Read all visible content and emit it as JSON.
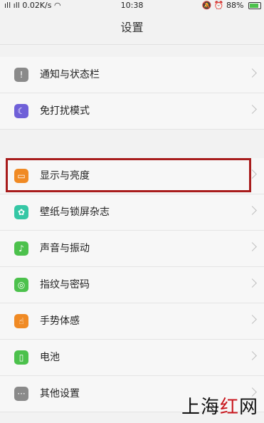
{
  "status_bar": {
    "network": "0.02K/s",
    "time": "10:38",
    "battery": "88%",
    "battery_level": 0.88
  },
  "header": {
    "title": "设置"
  },
  "colors": {
    "highlight": "#a81c1c",
    "icon_notification": "#8a8a8a",
    "icon_dnd": "#6f60d8",
    "icon_display": "#f08a24",
    "icon_wallpaper": "#35c7a5",
    "icon_sound": "#4cc14c",
    "icon_fingerprint": "#4cc14c",
    "icon_gesture": "#f08a24",
    "icon_battery": "#4cc14c",
    "icon_more": "#8a8a8a"
  },
  "section1": {
    "items": [
      {
        "label": "通知与状态栏",
        "icon": "notification-icon",
        "glyph": "!"
      },
      {
        "label": "免打扰模式",
        "icon": "moon-icon",
        "glyph": "☾"
      }
    ]
  },
  "section2": {
    "items": [
      {
        "label": "显示与亮度",
        "icon": "display-icon",
        "glyph": "▭"
      },
      {
        "label": "壁纸与锁屏杂志",
        "icon": "flower-icon",
        "glyph": "✿"
      },
      {
        "label": "声音与振动",
        "icon": "speaker-icon",
        "glyph": "♪"
      },
      {
        "label": "指纹与密码",
        "icon": "fingerprint-icon",
        "glyph": "◎"
      },
      {
        "label": "手势体感",
        "icon": "hand-icon",
        "glyph": "☝"
      },
      {
        "label": "电池",
        "icon": "battery-icon",
        "glyph": "▯"
      },
      {
        "label": "其他设置",
        "icon": "more-icon",
        "glyph": "···"
      }
    ]
  },
  "watermark": {
    "part1": "上海",
    "part2": "红",
    "part3": "网"
  }
}
